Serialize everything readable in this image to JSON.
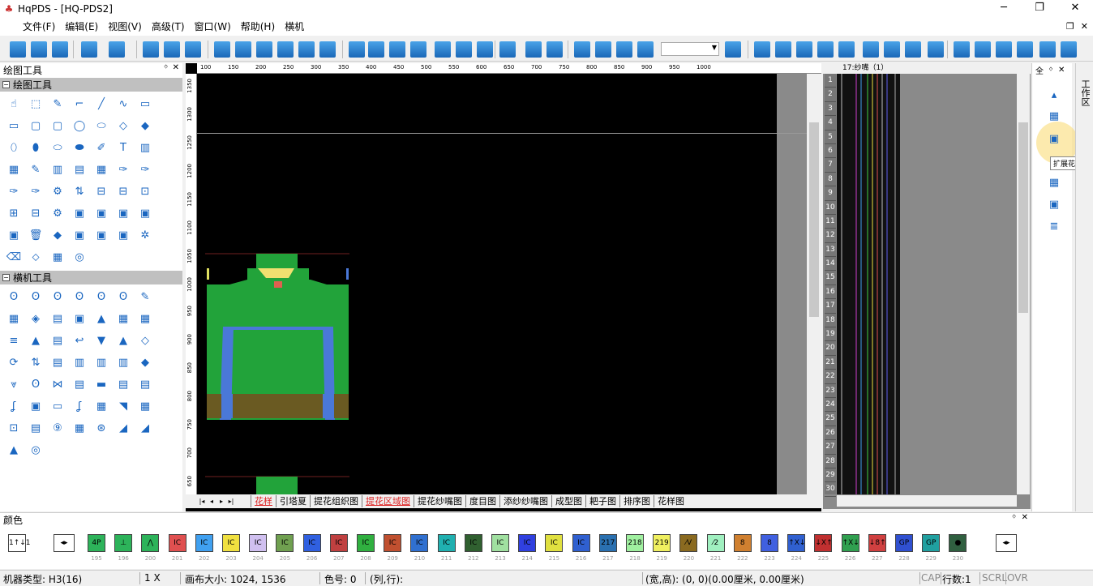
{
  "window": {
    "title": "HqPDS - [HQ-PDS2]",
    "min": "─",
    "max": "❐",
    "close": "✕"
  },
  "menu": {
    "items": [
      "文件(F)",
      "编辑(E)",
      "视图(V)",
      "高级(T)",
      "窗口(W)",
      "帮助(H)",
      "横机"
    ],
    "right": [
      "❐",
      "✕"
    ]
  },
  "left_panel": {
    "title": "绘图工具",
    "pin": "ᛜ",
    "close": "✕",
    "sections": [
      {
        "label": "绘图工具",
        "toggle": "−"
      },
      {
        "label": "横机工具",
        "toggle": "−"
      }
    ]
  },
  "canvas": {
    "ruler_x": [
      "100",
      "150",
      "200",
      "250",
      "300",
      "350",
      "400",
      "450",
      "500",
      "550",
      "600",
      "650",
      "700",
      "750",
      "800",
      "850",
      "900",
      "950",
      "1000"
    ],
    "ruler_y": [
      "1350",
      "1300",
      "1250",
      "1200",
      "1150",
      "1100",
      "1050",
      "1000",
      "950",
      "900",
      "850",
      "800",
      "750",
      "700",
      "650"
    ]
  },
  "tabs": {
    "nav": [
      "|◂",
      "◂",
      "▸",
      "▸|"
    ],
    "items": [
      "花样",
      "引塔夏",
      "提花组织图",
      "提花区域图",
      "提花纱嘴图",
      "度目图",
      "添纱纱嘴图",
      "成型图",
      "耙子图",
      "排序图",
      "花样图"
    ],
    "active": [
      0,
      3
    ]
  },
  "right_view": {
    "header": "17:纱嘴（1）",
    "rows": [
      "1",
      "2",
      "3",
      "4",
      "5",
      "6",
      "7",
      "8",
      "9",
      "10",
      "11",
      "12",
      "13",
      "14",
      "15",
      "16",
      "17",
      "18",
      "19",
      "20",
      "21",
      "22",
      "23",
      "24",
      "25",
      "26",
      "27",
      "28",
      "29",
      "30"
    ]
  },
  "right_side": {
    "all": "全",
    "tooltip": "扩展花样",
    "vertical_tab": "工作区"
  },
  "colors": {
    "title": "颜色",
    "swatches": [
      {
        "label": "1↑↓1",
        "num": "",
        "color": "#ffffff"
      },
      {
        "label": "4P",
        "num": "195",
        "color": "#2db35a"
      },
      {
        "label": "⊥",
        "num": "196",
        "color": "#2db35a"
      },
      {
        "label": "⋀",
        "num": "200",
        "color": "#2db35a"
      },
      {
        "label": "IC",
        "num": "201",
        "color": "#e05050"
      },
      {
        "label": "IC",
        "num": "202",
        "color": "#40a0f0"
      },
      {
        "label": "IC",
        "num": "203",
        "color": "#f0e040"
      },
      {
        "label": "IC",
        "num": "204",
        "color": "#d0c0f0"
      },
      {
        "label": "IC",
        "num": "205",
        "color": "#70a050"
      },
      {
        "label": "IC",
        "num": "206",
        "color": "#3060e0"
      },
      {
        "label": "IC",
        "num": "207",
        "color": "#c04040"
      },
      {
        "label": "IC",
        "num": "208",
        "color": "#30b040"
      },
      {
        "label": "IC",
        "num": "209",
        "color": "#c05030"
      },
      {
        "label": "IC",
        "num": "210",
        "color": "#3070d0"
      },
      {
        "label": "IC",
        "num": "211",
        "color": "#20b0b0"
      },
      {
        "label": "IC",
        "num": "212",
        "color": "#306030"
      },
      {
        "label": "IC",
        "num": "213",
        "color": "#a0e0a0"
      },
      {
        "label": "IC",
        "num": "214",
        "color": "#3040e0"
      },
      {
        "label": "IC",
        "num": "215",
        "color": "#e0e040"
      },
      {
        "label": "IC",
        "num": "216",
        "color": "#3060d0"
      },
      {
        "label": "217",
        "num": "217",
        "color": "#2a70b0"
      },
      {
        "label": "218",
        "num": "218",
        "color": "#a0f0a0"
      },
      {
        "label": "219",
        "num": "219",
        "color": "#f0f060"
      },
      {
        "label": "⁄V",
        "num": "220",
        "color": "#8a6a20"
      },
      {
        "label": "⁄2",
        "num": "221",
        "color": "#a0f0c0"
      },
      {
        "label": "8",
        "num": "222",
        "color": "#d08030"
      },
      {
        "label": "8",
        "num": "223",
        "color": "#4060e0"
      },
      {
        "label": "↑X↓",
        "num": "224",
        "color": "#3060d0"
      },
      {
        "label": "↓X↑",
        "num": "225",
        "color": "#c03030"
      },
      {
        "label": "↑X↓",
        "num": "226",
        "color": "#30a050"
      },
      {
        "label": "↓8↑",
        "num": "227",
        "color": "#d04040"
      },
      {
        "label": "GP",
        "num": "228",
        "color": "#3050d0"
      },
      {
        "label": "GP",
        "num": "229",
        "color": "#20a0a0"
      },
      {
        "label": "●",
        "num": "230",
        "color": "#306040"
      }
    ]
  },
  "status": {
    "machine": "机器类型: H3(16)",
    "zoom": "1 X",
    "canvas_size": "画布大小: 1024, 1536",
    "color_num": "色号: 0",
    "col_row": "(列,行):",
    "wh": "(宽,高): (0, 0)(0.00厘米, 0.00厘米)",
    "cap": "CAP",
    "rows": "行数:1",
    "scrl": "SCRL",
    "ovr": "OVR"
  }
}
